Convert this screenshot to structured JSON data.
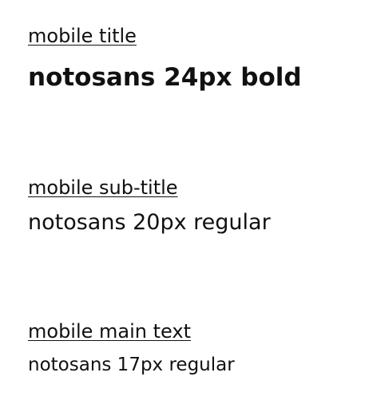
{
  "sections": [
    {
      "heading": "mobile title",
      "sample": "notosans 24px bold"
    },
    {
      "heading": "mobile sub-title",
      "sample": "notosans 20px regular"
    },
    {
      "heading": "mobile main text",
      "sample": "notosans 17px regular"
    }
  ]
}
